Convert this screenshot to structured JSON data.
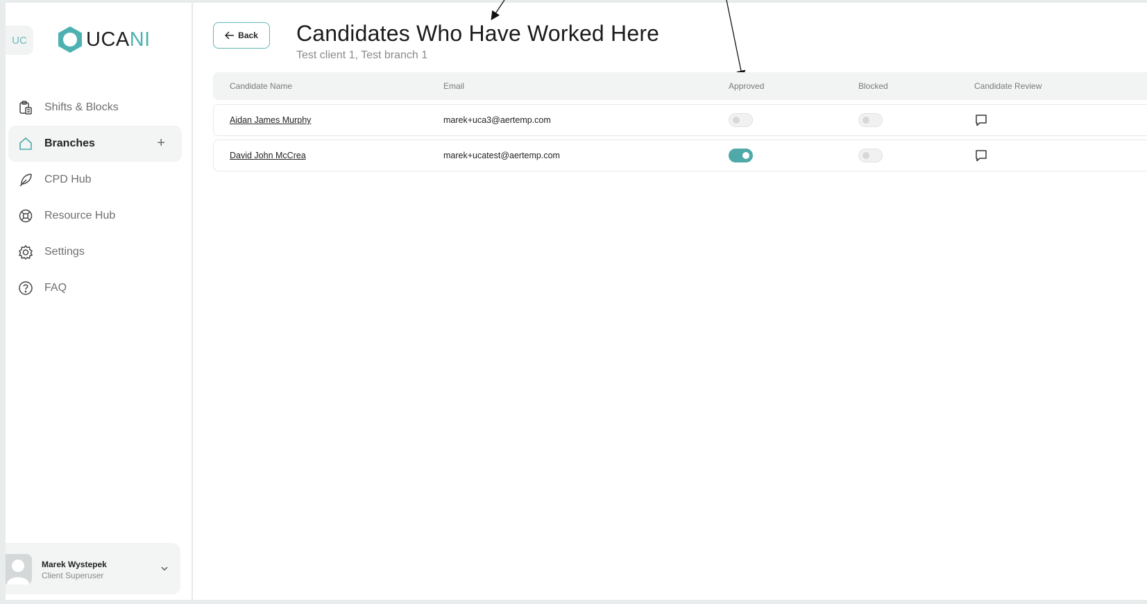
{
  "sidebar": {
    "badge": "UC",
    "logo": {
      "part1": "UCA",
      "part2": "NI"
    },
    "items": [
      {
        "label": "Shifts & Blocks",
        "icon": "clipboard-icon"
      },
      {
        "label": "Branches",
        "icon": "home-icon",
        "active": true,
        "action": "+"
      },
      {
        "label": "CPD Hub",
        "icon": "feather-icon"
      },
      {
        "label": "Resource Hub",
        "icon": "lifebuoy-icon"
      },
      {
        "label": "Settings",
        "icon": "gear-icon"
      },
      {
        "label": "FAQ",
        "icon": "question-icon"
      }
    ],
    "user": {
      "name": "Marek Wystepek",
      "role": "Client Superuser"
    }
  },
  "header": {
    "back_label": "Back",
    "title": "Candidates Who Have Worked Here",
    "subtitle": "Test client 1, Test branch 1"
  },
  "table": {
    "columns": [
      "Candidate Name",
      "Email",
      "Approved",
      "Blocked",
      "Candidate Review"
    ],
    "rows": [
      {
        "name": "Aidan James Murphy",
        "email": "marek+uca3@aertemp.com",
        "approved": false,
        "blocked": false
      },
      {
        "name": "David John McCrea",
        "email": "marek+ucatest@aertemp.com",
        "approved": true,
        "blocked": false
      }
    ]
  },
  "colors": {
    "accent": "#4ea9a8",
    "nav_active_bg": "#f3f4f4"
  }
}
